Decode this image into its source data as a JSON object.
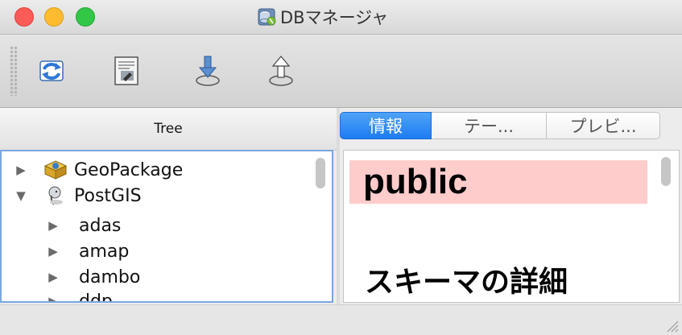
{
  "window": {
    "title": "DBマネージャ",
    "icon": "database-icon"
  },
  "toolbar": {
    "buttons": [
      {
        "name": "refresh",
        "icon": "refresh-icon"
      },
      {
        "name": "sql-window",
        "icon": "sql-window-icon"
      },
      {
        "name": "import",
        "icon": "import-layer-icon"
      },
      {
        "name": "export",
        "icon": "export-icon"
      }
    ]
  },
  "tree": {
    "header": "Tree",
    "items": [
      {
        "label": "GeoPackage",
        "expanded": false,
        "icon": "geopackage-icon"
      },
      {
        "label": "PostGIS",
        "expanded": true,
        "icon": "postgis-elephant-icon"
      },
      {
        "label": "adas",
        "expanded": false
      },
      {
        "label": "amap",
        "expanded": false
      },
      {
        "label": "dambo",
        "expanded": false
      },
      {
        "label": "ddp",
        "expanded": false
      }
    ]
  },
  "tabs": [
    {
      "label": "情報",
      "active": true
    },
    {
      "label": "テー...",
      "active": false
    },
    {
      "label": "プレビ...",
      "active": false
    }
  ],
  "info": {
    "schema_name": "public",
    "detail_heading": "スキーマの詳細"
  },
  "colors": {
    "tab_active": "#1d7cf2",
    "schema_banner_bg": "#ffcccc",
    "tree_focus_border": "#7aa7e0"
  }
}
